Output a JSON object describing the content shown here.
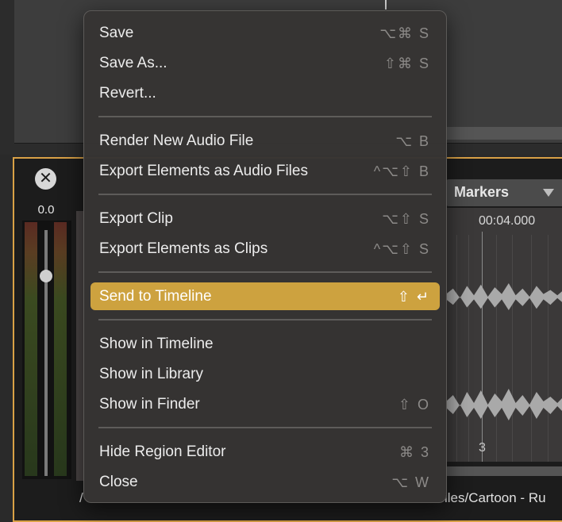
{
  "background": {
    "level_value": "0.0",
    "close_glyph": "✕",
    "markers_label": "Markers",
    "timecode": "00:04.000",
    "tick_label": "3",
    "path_start": "/",
    "path_text": "iles/Cartoon - Ru"
  },
  "menu": {
    "save": {
      "label": "Save",
      "shortcut": "⌥⌘ S"
    },
    "save_as": {
      "label": "Save As...",
      "shortcut": "⇧⌘ S"
    },
    "revert": {
      "label": "Revert...",
      "shortcut": ""
    },
    "render_new_audio": {
      "label": "Render New Audio File",
      "shortcut": "⌥ B"
    },
    "export_elements_audio": {
      "label": "Export Elements as Audio Files",
      "shortcut": "^⌥⇧ B"
    },
    "export_clip": {
      "label": "Export Clip",
      "shortcut": "⌥⇧ S"
    },
    "export_elements_clips": {
      "label": "Export Elements as Clips",
      "shortcut": "^⌥⇧ S"
    },
    "send_to_timeline": {
      "label": "Send to Timeline",
      "shortcut": "⇧ ↵"
    },
    "show_in_timeline": {
      "label": "Show in Timeline",
      "shortcut": ""
    },
    "show_in_library": {
      "label": "Show in Library",
      "shortcut": ""
    },
    "show_in_finder": {
      "label": "Show in Finder",
      "shortcut": "⇧ O"
    },
    "hide_region_editor": {
      "label": "Hide Region Editor",
      "shortcut": "⌘ 3"
    },
    "close": {
      "label": "Close",
      "shortcut": "⌥ W"
    }
  },
  "colors": {
    "highlight": "#cda23f",
    "editor_border": "#d9a146",
    "menu_bg": "#363433"
  }
}
